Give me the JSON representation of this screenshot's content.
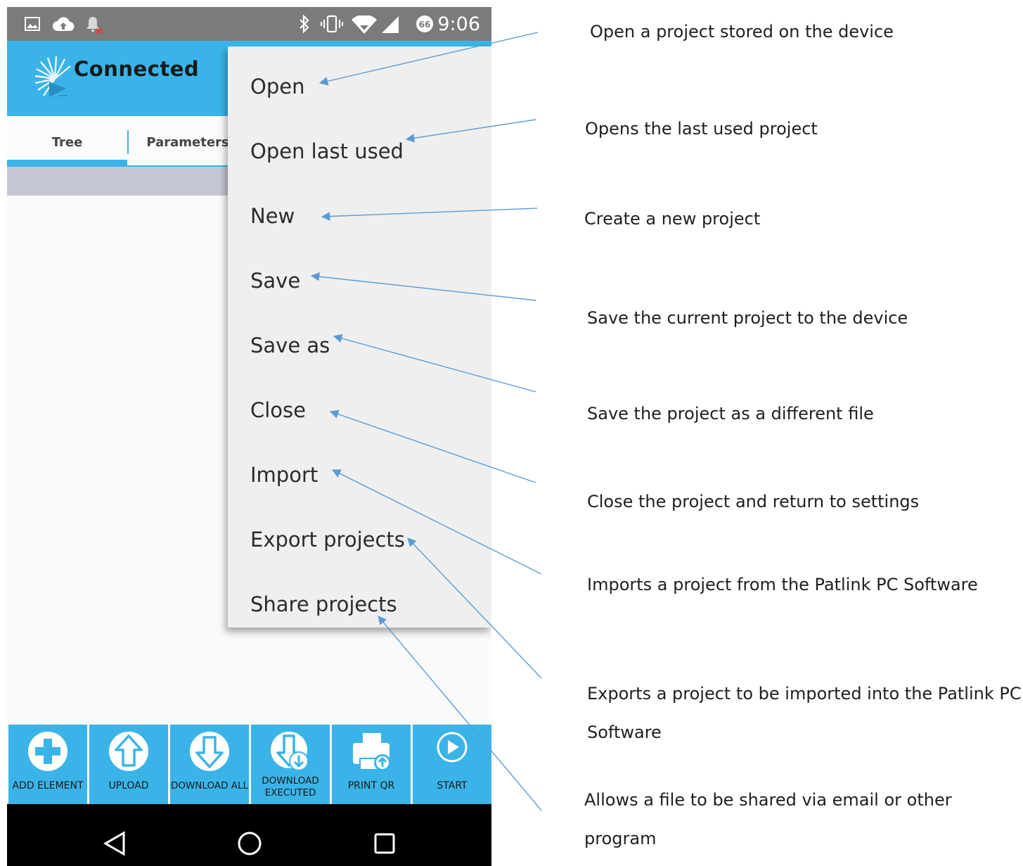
{
  "status_bar": {
    "time": "9:06",
    "battery_level": "66",
    "icons": [
      "image-icon",
      "cloud-upload-icon",
      "notification-bell-icon",
      "bluetooth-icon",
      "vibrate-icon",
      "wifi-icon",
      "cellular-signal-icon",
      "battery-saver-icon"
    ]
  },
  "app_bar": {
    "title": "Connected",
    "logo": "app-logo-icon"
  },
  "tabs": [
    {
      "label": "Tree"
    },
    {
      "label": "Parameters"
    }
  ],
  "menu": {
    "items": [
      {
        "label": "Open"
      },
      {
        "label": "Open last used"
      },
      {
        "label": "New"
      },
      {
        "label": "Save"
      },
      {
        "label": "Save as"
      },
      {
        "label": "Close"
      },
      {
        "label": "Import"
      },
      {
        "label": "Export projects"
      },
      {
        "label": "Share projects"
      }
    ]
  },
  "toolbar": {
    "buttons": [
      {
        "label": "ADD ELEMENT",
        "icon": "add-circle-icon"
      },
      {
        "label": "UPLOAD",
        "icon": "upload-arrow-icon"
      },
      {
        "label": "DOWNLOAD ALL",
        "icon": "download-arrow-icon"
      },
      {
        "label_line1": "DOWNLOAD",
        "label_line2": "EXECUTED",
        "icon": "download-executed-icon"
      },
      {
        "label": "PRINT QR",
        "icon": "printer-icon"
      },
      {
        "label": "START",
        "icon": "play-icon"
      }
    ]
  },
  "nav_bar": {
    "icons": [
      "back-triangle-icon",
      "home-circle-icon",
      "recents-square-icon"
    ]
  },
  "annotations": [
    {
      "text": "Open a project stored on the device"
    },
    {
      "text": "Opens the last used project"
    },
    {
      "text": "Create a new project"
    },
    {
      "text": "Save the current project to the device"
    },
    {
      "text": "Save the project as a different file"
    },
    {
      "text": "Close the project and return to settings"
    },
    {
      "text": "Imports a project from the Patlink PC Software"
    },
    {
      "line1": "Exports a project to be imported into the Patlink PC",
      "line2": "Software"
    },
    {
      "line1": "Allows a file to be shared via email or other",
      "line2": "program"
    }
  ],
  "colors": {
    "accent": "#3ab4e8",
    "status_bar": "#7b7b7b",
    "menu_background": "#efefef",
    "arrow": "#5b9bd5",
    "nav_bar": "#000000"
  }
}
